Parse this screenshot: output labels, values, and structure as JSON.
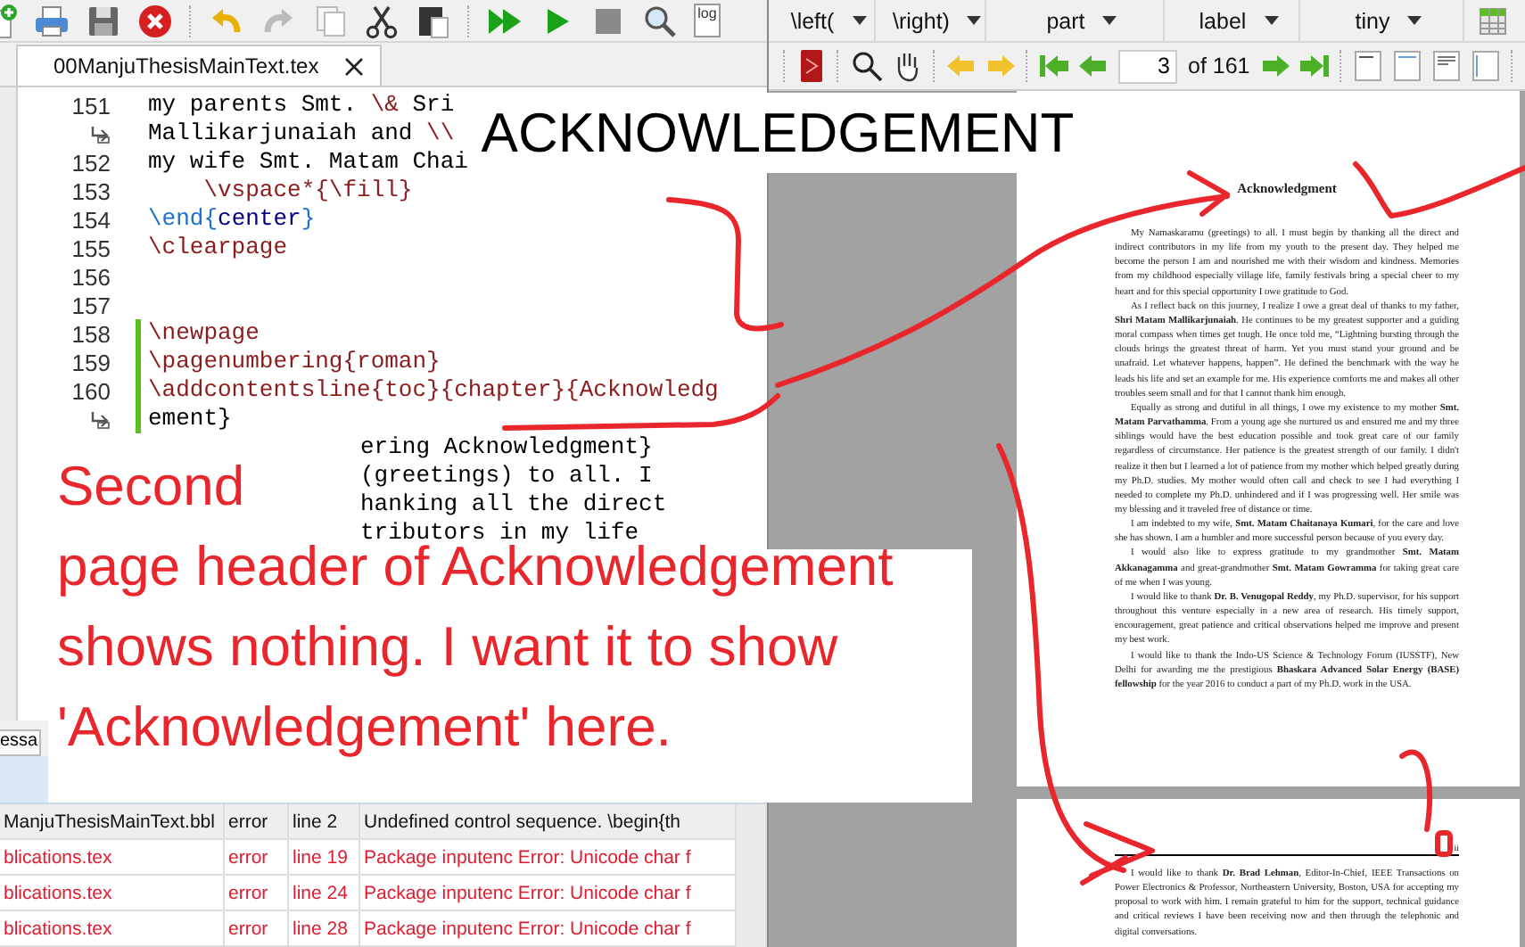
{
  "toolbar": {
    "log_label": "log",
    "dropdowns": [
      {
        "label": "\\left("
      },
      {
        "label": "\\right)"
      },
      {
        "label": "part"
      },
      {
        "label": "label"
      },
      {
        "label": "tiny"
      }
    ]
  },
  "editor": {
    "tab": {
      "title": "00ManjuThesisMainText.tex"
    },
    "lines": [
      {
        "kind": "line",
        "number": "151",
        "modified": false,
        "segments": [
          {
            "kind": "text",
            "text": "my parents Smt. "
          },
          {
            "kind": "command",
            "text": "\\&"
          },
          {
            "kind": "text",
            "text": " Sri"
          }
        ]
      },
      {
        "kind": "wrap",
        "modified": false,
        "segments": [
          {
            "kind": "text",
            "text": "Mallikarjunaiah and "
          },
          {
            "kind": "command",
            "text": "\\\\"
          }
        ]
      },
      {
        "kind": "line",
        "number": "152",
        "modified": false,
        "segments": [
          {
            "kind": "text",
            "text": "my wife Smt. Matam Chai"
          }
        ]
      },
      {
        "kind": "line",
        "number": "153",
        "modified": false,
        "segments": [
          {
            "kind": "command",
            "text": "    \\vspace*{\\fill}"
          }
        ]
      },
      {
        "kind": "line",
        "number": "154",
        "modified": false,
        "segments": [
          {
            "kind": "env",
            "text": "\\end{"
          },
          {
            "kind": "arg",
            "text": "center"
          },
          {
            "kind": "env",
            "text": "}"
          }
        ]
      },
      {
        "kind": "line",
        "number": "155",
        "modified": false,
        "segments": [
          {
            "kind": "command",
            "text": "\\clearpage"
          }
        ]
      },
      {
        "kind": "line",
        "number": "156",
        "modified": false
      },
      {
        "kind": "line",
        "number": "157",
        "modified": false
      },
      {
        "kind": "line",
        "number": "158",
        "modified": true,
        "segments": [
          {
            "kind": "command",
            "text": "\\newpage"
          }
        ]
      },
      {
        "kind": "line",
        "number": "159",
        "modified": true,
        "segments": [
          {
            "kind": "command",
            "text": "\\pagenumbering{roman}"
          }
        ]
      },
      {
        "kind": "line",
        "number": "160",
        "modified": true,
        "segments": [
          {
            "kind": "command",
            "text": "\\addcontentsline{toc}{chapter}{Acknowledg"
          }
        ]
      },
      {
        "kind": "wrap",
        "modified": true,
        "segments": [
          {
            "kind": "text",
            "text": "ement}"
          }
        ]
      },
      {
        "kind": "covered",
        "segments": [
          {
            "kind": "text",
            "text": "ering Acknowledgment}"
          }
        ]
      },
      {
        "kind": "covered",
        "segments": [
          {
            "kind": "text",
            "text": "(greetings) to all. I"
          }
        ]
      },
      {
        "kind": "covered",
        "segments": [
          {
            "kind": "text",
            "text": "hanking all the direct"
          }
        ]
      },
      {
        "kind": "covered",
        "segments": [
          {
            "kind": "text",
            "text": "tributors in my life"
          }
        ]
      }
    ]
  },
  "messages": {
    "tab_label": "essa",
    "rows": [
      {
        "file": "ManjuThesisMainText.bbl",
        "type": "error",
        "line": "line 2",
        "message": "Undefined control sequence. \\begin{th",
        "selected": true
      },
      {
        "file": "blications.tex",
        "type": "error",
        "line": "line 19",
        "message": "Package inputenc Error: Unicode char f",
        "selected": false
      },
      {
        "file": "blications.tex",
        "type": "error",
        "line": "line 24",
        "message": "Package inputenc Error: Unicode char f",
        "selected": false
      },
      {
        "file": "blications.tex",
        "type": "error",
        "line": "line 28",
        "message": "Package inputenc Error: Unicode char f",
        "selected": false
      }
    ]
  },
  "pdf_viewer": {
    "page_field": "3",
    "page_count": "of 161",
    "pages": [
      {
        "title": "Acknowledgment",
        "paragraphs": [
          "My Namaskaramu (greetings) to all. I must begin by thanking all the direct and indirect contributors in my life from my youth to the present day. They helped me become the person I am and nourished me with their wisdom and kindness. Memories from my childhood especially village life, family festivals bring a special cheer to my heart and for this special opportunity I owe gratitude to God.",
          "As I reflect back on this journey, I realize I owe a great deal of thanks to my father, **Shri Matam Mallikarjunaiah**. He continues to be my greatest supporter and a guiding moral compass when times get tough. He once told me, “Lightning bursting through the clouds brings the greatest threat of harm. Yet you must stand your ground and be unafraid. Let whatever happens, happen”. He defined the benchmark with the way he leads his life and set an example for me. His experience comforts me and makes all other troubles seem small and for that I cannot thank him enough.",
          "Equally as strong and dutiful in all things, I owe my existence to my mother **Smt. Matam Parvathamma**. From a young age she nurtured us and ensured me and my three siblings would have the best education possible and took great care of our family regardless of circumstance. Her patience is the greatest strength of our family. I didn't realize it then but I learned a lot of patience from my mother which helped greatly during my Ph.D. studies. My mother would often call and check to see I had everything I needed to complete my Ph.D. unhindered and if I was progressing well. Her smile was my blessing and it traveled free of distance or time.",
          "I am indebted to my wife, **Smt. Matam Chaitanaya Kumari**, for the care and love she has shown. I am a humbler and more successful person because of you every day.",
          "I would also like to express gratitude to my grandmother **Smt. Matam Akkanagamma** and great-grandmother **Smt. Matam Gowramma** for taking great care of me when I was young.",
          "I would like to thank **Dr. B. Venugopal Reddy**, my Ph.D. supervisor, for his support throughout this venture especially in a new area of research. His timely support, encouragement, great patience and critical observations helped me improve and present my best work.",
          "I would like to thank the Indo-US Science & Technology Forum (IUSSTF), New Delhi for awarding me the prestigious **Bhaskara Advanced Solar Energy (BASE) fellowship** for the year 2016 to conduct a part of my Ph.D. work in the USA."
        ]
      },
      {
        "header_page_number": "ii",
        "paragraphs": [
          "I would like to thank **Dr. Brad Lehman**, Editor-In-Chief, IEEE Transactions on Power Electronics & Professor, Northeastern University, Boston, USA for accepting my proposal to work with him. I remain grateful to him for the support, technical guidance and critical reviews I have been receiving now and then through the telephonic and digital conversations."
        ]
      }
    ]
  },
  "overlay_heading": "ACKNOWLEDGEMENT",
  "callout": "Second page header of Acknowledgement shows nothing. I want it to show 'Acknowledgement' here."
}
